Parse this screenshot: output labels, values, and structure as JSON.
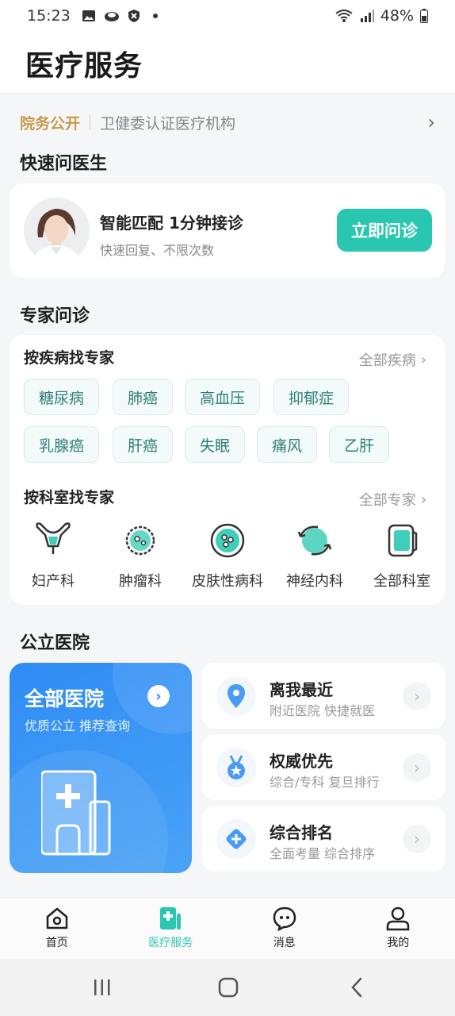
{
  "status_bar": {
    "time": "15:23",
    "battery": "48%"
  },
  "header": {
    "title": "医疗服务"
  },
  "notice": {
    "tag": "院务公开",
    "text": "卫健委认证医疗机构"
  },
  "quick_consult": {
    "section_title": "快速问医生",
    "main_text": "智能匹配 1分钟接诊",
    "sub_text": "快速回复、不限次数",
    "button_label": "立即问诊"
  },
  "experts": {
    "section_title": "专家问诊",
    "by_disease_title": "按疾病找专家",
    "all_diseases_label": "全部疾病",
    "diseases": [
      "糖尿病",
      "肺癌",
      "高血压",
      "抑郁症",
      "乳腺癌",
      "肝癌",
      "失眠",
      "痛风",
      "乙肝"
    ],
    "by_dept_title": "按科室找专家",
    "all_experts_label": "全部专家",
    "departments": [
      {
        "label": "妇产科",
        "icon": "uterus-icon"
      },
      {
        "label": "肿瘤科",
        "icon": "tumor-cell-icon"
      },
      {
        "label": "皮肤性病科",
        "icon": "skin-icon"
      },
      {
        "label": "神经内科",
        "icon": "neuro-icon"
      },
      {
        "label": "全部科室",
        "icon": "all-depts-icon"
      }
    ]
  },
  "hospitals": {
    "section_title": "公立医院",
    "all_title": "全部医院",
    "all_sub": "优质公立 推荐查询",
    "items": [
      {
        "title": "离我最近",
        "sub": "附近医院 快捷就医",
        "icon": "location-pin-icon"
      },
      {
        "title": "权威优先",
        "sub": "综合/专科 复旦排行",
        "icon": "medal-icon"
      },
      {
        "title": "综合排名",
        "sub": "全面考量 综合排序",
        "icon": "diamond-plus-icon"
      }
    ]
  },
  "bottom_nav": {
    "items": [
      {
        "label": "首页",
        "icon": "home-icon"
      },
      {
        "label": "医疗服务",
        "icon": "medical-service-icon",
        "active": true
      },
      {
        "label": "消息",
        "icon": "message-icon"
      },
      {
        "label": "我的",
        "icon": "profile-icon"
      }
    ]
  },
  "colors": {
    "accent": "#2ac7b0",
    "gold": "#c79a4e",
    "blue": "#2f8cf5"
  }
}
